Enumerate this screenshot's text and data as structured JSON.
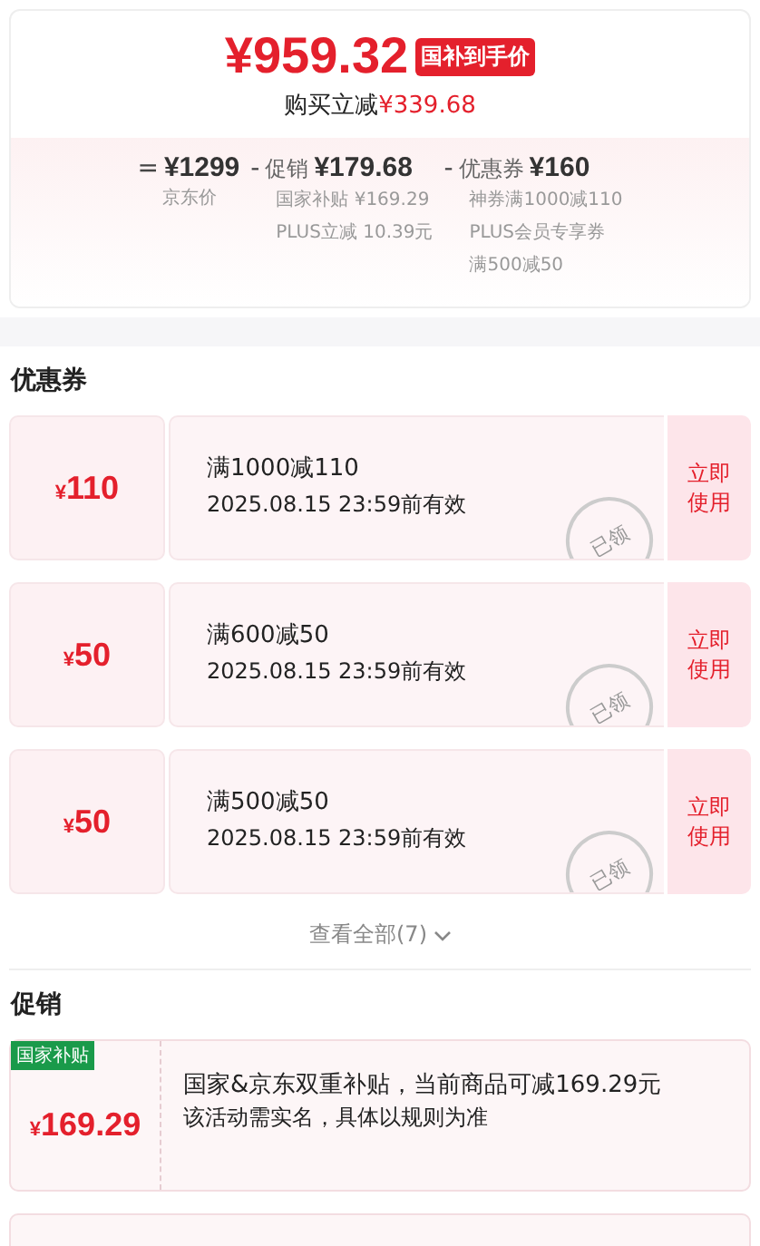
{
  "price_card": {
    "final_price": "¥959.32",
    "price_tag": "国补到手价",
    "saving_label": "购买立减",
    "saving_amount": "¥339.68",
    "breakdown": [
      {
        "operator": "=",
        "amount": "¥1299",
        "notes": [
          "京东价"
        ]
      },
      {
        "operator": "-",
        "label": "促销",
        "amount": "¥179.68",
        "notes": [
          "国家补贴 ¥169.29",
          "PLUS立减 10.39元"
        ]
      },
      {
        "operator": "-",
        "label": "优惠券",
        "amount": "¥160",
        "notes": [
          "神券满1000减110",
          "PLUS会员专享券",
          "满500减50"
        ]
      }
    ]
  },
  "coupons": {
    "title": "优惠券",
    "items": [
      {
        "currency": "¥",
        "amount": "110",
        "condition": "满1000减110",
        "validity": "2025.08.15 23:59前有效",
        "action": "立即使用",
        "stamp": "已领"
      },
      {
        "currency": "¥",
        "amount": "50",
        "condition": "满600减50",
        "validity": "2025.08.15 23:59前有效",
        "action": "立即使用",
        "stamp": "已领"
      },
      {
        "currency": "¥",
        "amount": "50",
        "condition": "满500减50",
        "validity": "2025.08.15 23:59前有效",
        "action": "立即使用",
        "stamp": "已领"
      }
    ],
    "view_all": "查看全部(7)"
  },
  "promotions": {
    "title": "促销",
    "items": [
      {
        "tag": "国家补贴",
        "currency": "¥",
        "amount": "169.29",
        "description": "国家&京东双重补贴，当前商品可减169.29元",
        "note": "该活动需实名，具体以规则为准"
      }
    ]
  }
}
